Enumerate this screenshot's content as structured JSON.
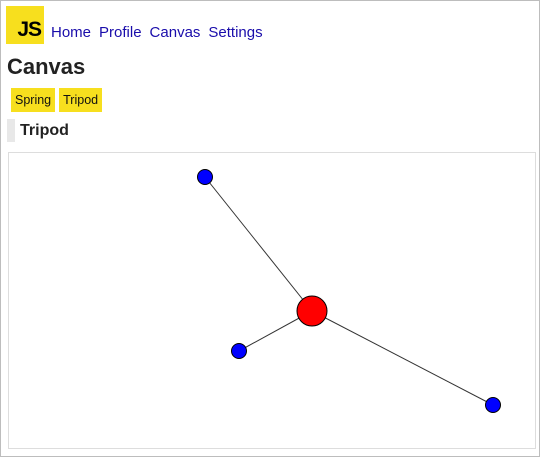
{
  "header": {
    "logo_text": "JS",
    "logo_color": "#f7df1e",
    "nav": [
      "Home",
      "Profile",
      "Canvas",
      "Settings"
    ]
  },
  "page": {
    "title": "Canvas"
  },
  "tabs": {
    "items": [
      "Spring",
      "Tripod"
    ],
    "active_color": "#f7df1e"
  },
  "section": {
    "title": "Tripod"
  },
  "graph": {
    "center": {
      "color": "#ff0000"
    },
    "leaf": {
      "color": "#0000ff"
    },
    "edge_color": "#333333"
  }
}
